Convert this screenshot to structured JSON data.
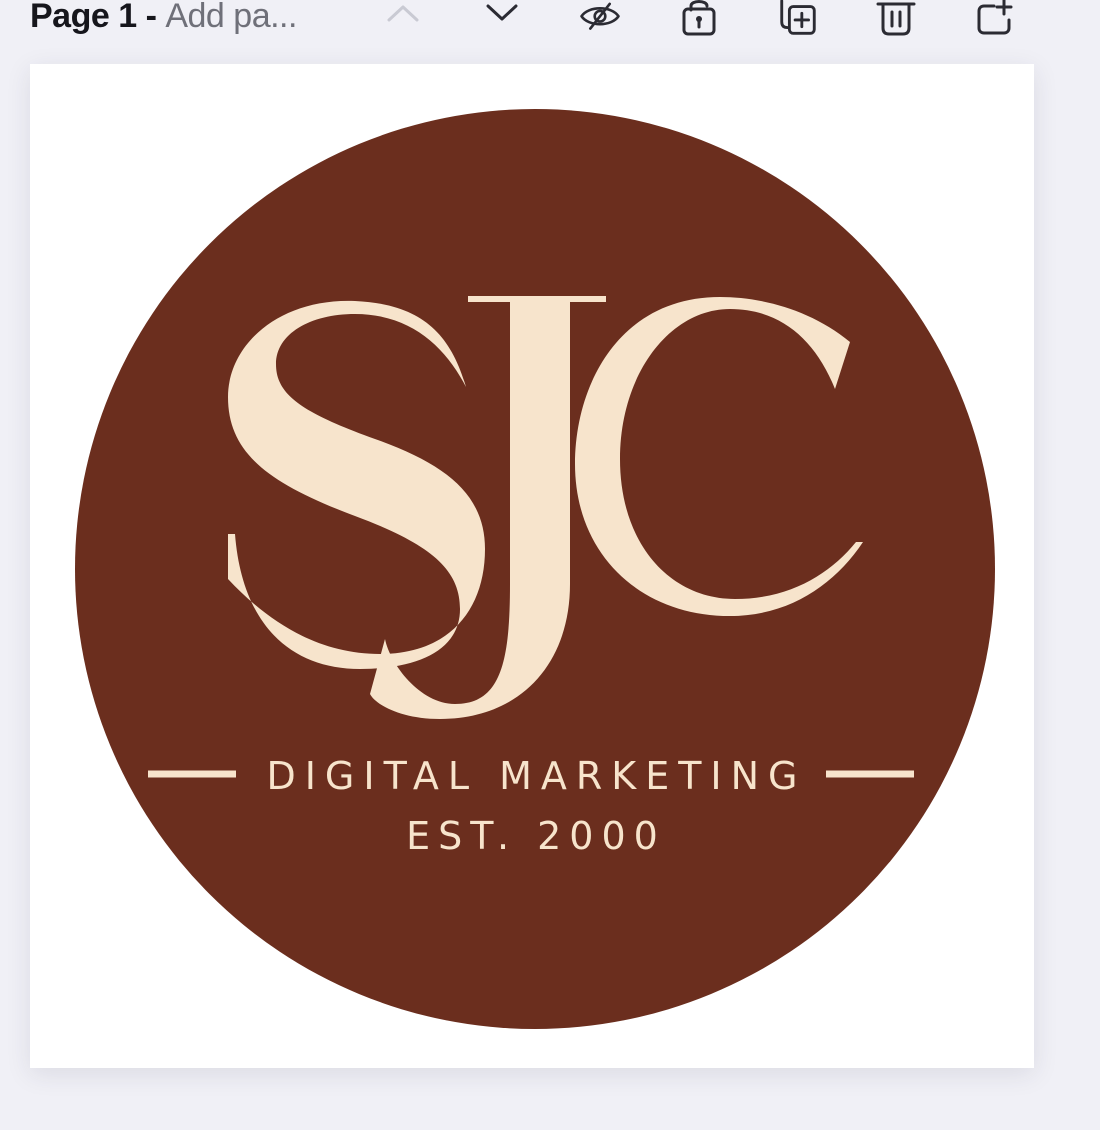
{
  "toolbar": {
    "page_label": "Page 1",
    "separator": " - ",
    "page_title_placeholder": "Add pa...",
    "icons": [
      "chevron-up-icon",
      "chevron-down-icon",
      "eye-hide-icon",
      "lock-icon",
      "duplicate-page-icon",
      "trash-icon",
      "add-page-icon"
    ]
  },
  "logo": {
    "monogram": "SJC",
    "tagline": "DIGITAL MARKETING",
    "established": "EST. 2000",
    "colors": {
      "circle": "#6b2e1e",
      "text": "#f7e4cc"
    }
  },
  "colors": {
    "workspace_bg": "#f0f0f6",
    "page_bg": "#ffffff"
  }
}
